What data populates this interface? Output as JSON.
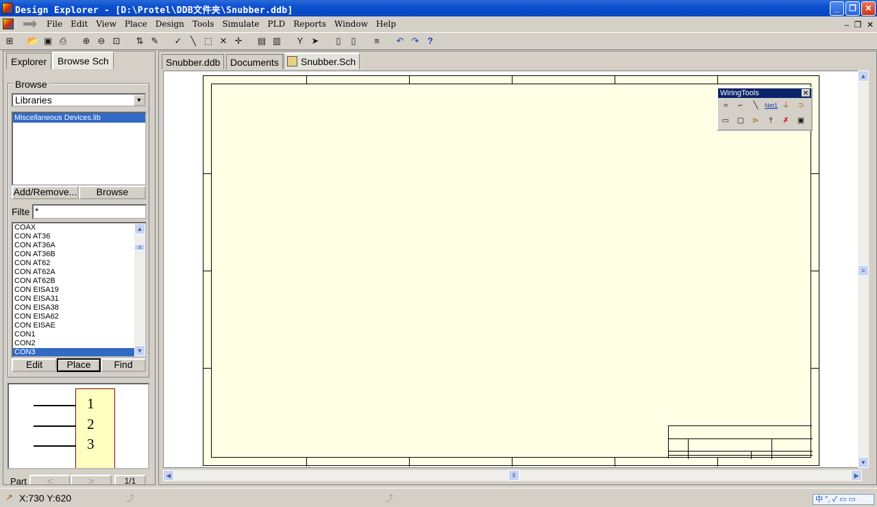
{
  "window": {
    "title": "Design Explorer - [D:\\Protel\\DDB文件夹\\Snubber.ddb]",
    "minimize": "_",
    "restore": "❐",
    "close": "✕"
  },
  "menubar": {
    "items": [
      "File",
      "Edit",
      "View",
      "Place",
      "Design",
      "Tools",
      "Simulate",
      "PLD",
      "Reports",
      "Window",
      "Help"
    ],
    "mdi_minimize": "–",
    "mdi_restore": "❐",
    "mdi_close": "✕"
  },
  "left_panel": {
    "tabs": [
      "Explorer",
      "Browse Sch"
    ],
    "active_tab": "Browse Sch",
    "browse_title": "Browse",
    "browse_select": "Libraries",
    "libraries": [
      "Miscellaneous Devices.lib"
    ],
    "add_remove_button": "Add/Remove...",
    "browse_button": "Browse",
    "filter_label": "Filte",
    "filter_value": "*",
    "components": [
      "COAX",
      "CON AT36",
      "CON AT36A",
      "CON AT36B",
      "CON AT62",
      "CON AT62A",
      "CON AT62B",
      "CON EISA19",
      "CON EISA31",
      "CON EISA38",
      "CON EISA62",
      "CON EISAE",
      "CON1",
      "CON2",
      "CON3"
    ],
    "selected_component": "CON3",
    "edit_button": "Edit",
    "place_button": "Place",
    "find_button": "Find",
    "preview_pins": [
      "1",
      "2",
      "3"
    ],
    "part_label": "Part",
    "part_prev": "<",
    "part_next": ">",
    "part_count": "1/1"
  },
  "doc_tabs": [
    "Snubber.ddb",
    "Documents",
    "Snubber.Sch"
  ],
  "active_doc_tab": "Snubber.Sch",
  "wiring_tools": {
    "title": "WiringTools",
    "close": "✕",
    "net_label": "Net1"
  },
  "status": {
    "coordinates": "X:730 Y:620",
    "ime": "中 °, ✓ ▭ ▭"
  }
}
